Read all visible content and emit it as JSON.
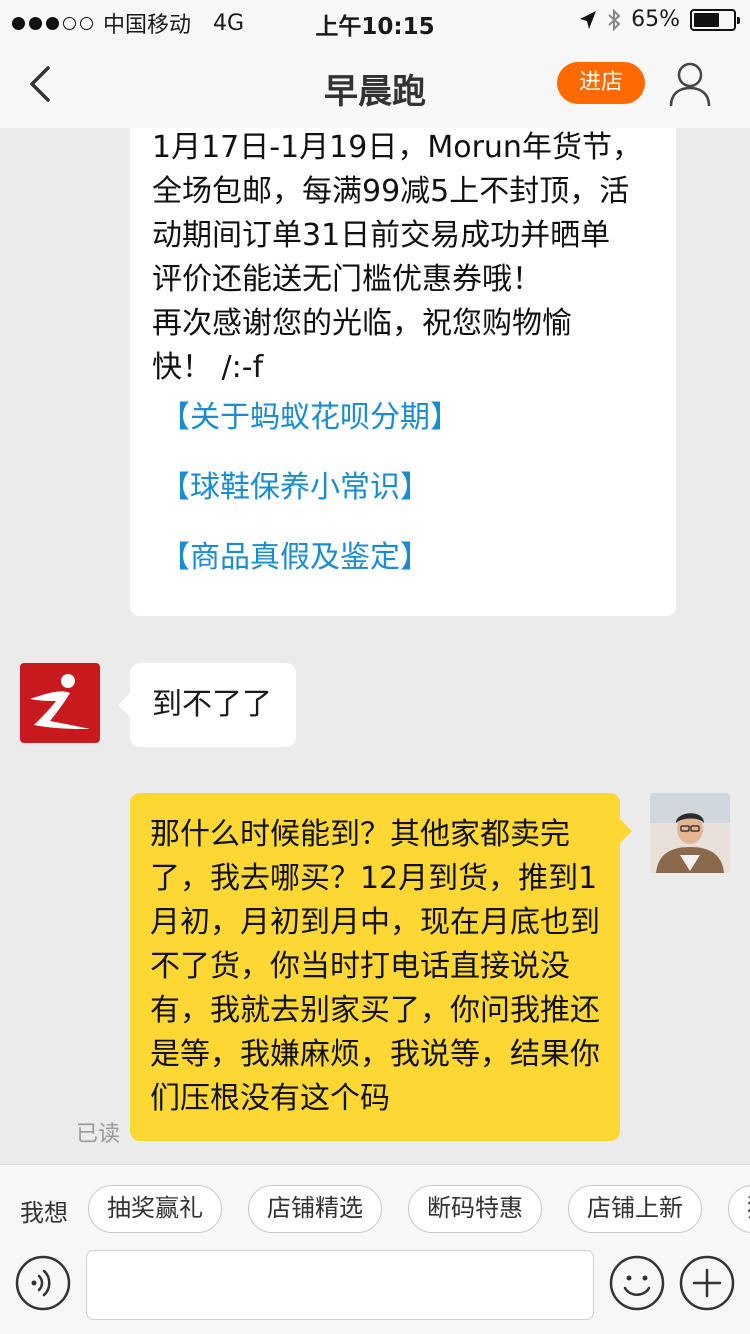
{
  "status_bar": {
    "carrier": "中国移动",
    "network": "4G",
    "time": "上午10:15",
    "battery": "65%",
    "battery_level": 0.65
  },
  "header": {
    "title": "早晨跑",
    "enter_store_label": "进店"
  },
  "messages": {
    "card": {
      "text": "1月17日-1月19日，Morun年货节，\n全场包邮，每满99减5上不封顶，活\n动期间订单31日前交易成功并晒单\n评价还能送无门槛优惠券哦！\n再次感谢您的光临，祝您购物愉\n快！ /:-f",
      "links": [
        "【关于蚂蚁花呗分期】",
        "【球鞋保养小常识】",
        "【商品真假及鉴定】"
      ]
    },
    "shop_reply": "到不了了",
    "my_message": "那什么时候能到？其他家都卖完了，我去哪买？12月到货，推到1月初，月初到月中，现在月底也到不了货，你当时打电话直接说没有，我就去别家买了，你问我推还是等，我嫌麻烦，我说等，结果你们压根没有这个码",
    "read_status": "已读"
  },
  "quick_replies": {
    "label": "我想",
    "chips": [
      "抽奖赢礼",
      "店铺精选",
      "断码特惠",
      "店铺上新",
      "猜"
    ]
  },
  "input": {
    "placeholder": ""
  },
  "colors": {
    "accent": "#ff6a00",
    "link": "#1a8cd1",
    "my_bubble": "#fdd835",
    "shop_avatar": "#c8191e"
  }
}
